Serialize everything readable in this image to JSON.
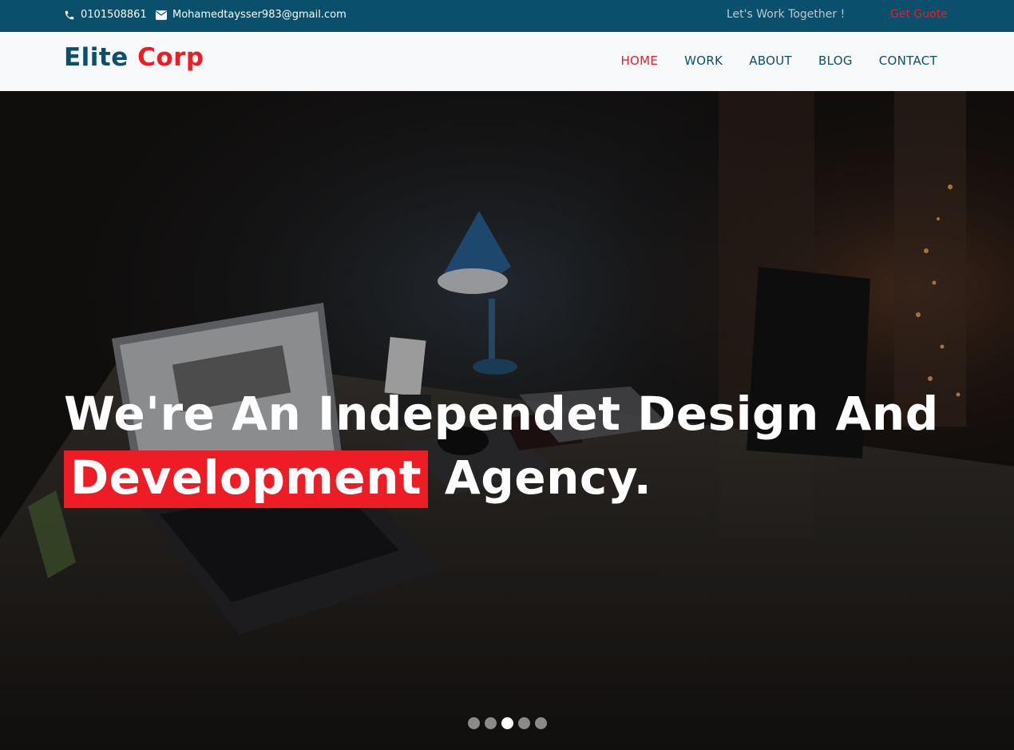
{
  "topbar": {
    "phone": "0101508861",
    "email": "Mohamedtaysser983@gmail.com",
    "tagline": "Let's Work Together !",
    "cta": "Get Guote",
    "icons": {
      "phone": "phone-icon",
      "email": "envelope-icon"
    }
  },
  "brand": {
    "part1": "Elite",
    "part2": "Corp"
  },
  "nav": {
    "items": [
      {
        "label": "HOME",
        "active": true
      },
      {
        "label": "WORK"
      },
      {
        "label": "ABOUT"
      },
      {
        "label": "BLOG"
      },
      {
        "label": "CONTACT"
      }
    ]
  },
  "hero": {
    "line1": "We're An Independet Design And",
    "highlight": "Development",
    "line2_rest": " Agency.",
    "slide_count": 5,
    "active_slide": 3
  },
  "colors": {
    "primary": "#0a4f6b",
    "accent": "#ee1c25",
    "nav_bg": "#f8f9fb"
  }
}
